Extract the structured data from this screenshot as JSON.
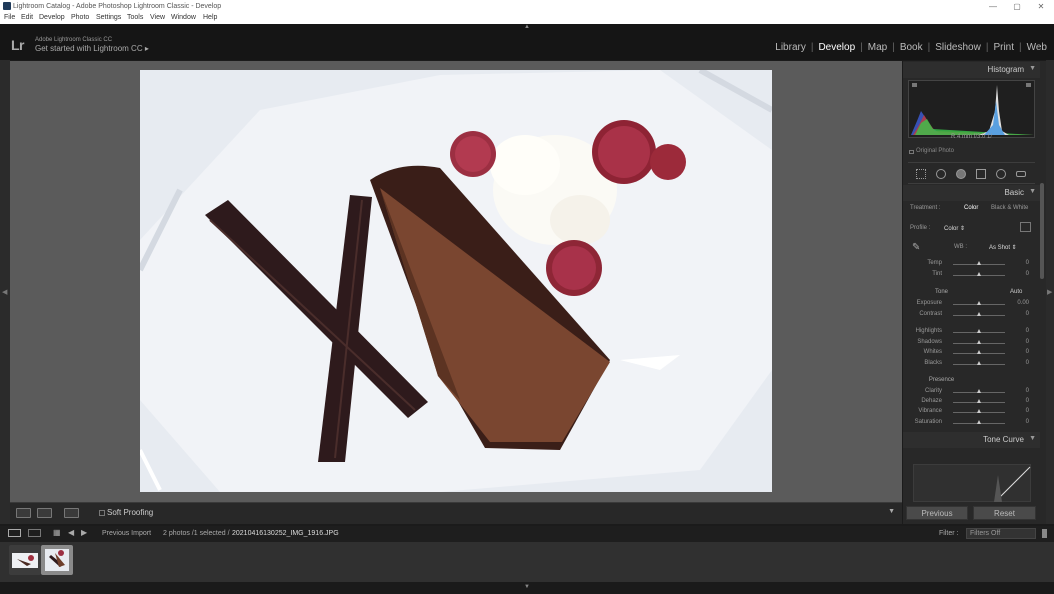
{
  "window": {
    "title": "Lightroom Catalog - Adobe Photoshop Lightroom Classic - Develop",
    "controls": [
      "—",
      "▢",
      "✕"
    ]
  },
  "menu": [
    "File",
    "Edit",
    "Develop",
    "Photo",
    "Settings",
    "Tools",
    "View",
    "Window",
    "Help"
  ],
  "identity": {
    "logo": "Lr",
    "line1": "Adobe Lightroom Classic CC",
    "line2": "Get started with Lightroom CC ▸"
  },
  "modules": [
    {
      "label": "Library",
      "active": false
    },
    {
      "label": "Develop",
      "active": true
    },
    {
      "label": "Map",
      "active": false
    },
    {
      "label": "Book",
      "active": false
    },
    {
      "label": "Slideshow",
      "active": false
    },
    {
      "label": "Print",
      "active": false
    },
    {
      "label": "Web",
      "active": false
    }
  ],
  "toolbar": {
    "soft_proofing": "Soft Proofing"
  },
  "histogram": {
    "title": "Histogram",
    "info": "R  4 mm  f/3.0  1/",
    "original_photo": "Original Photo"
  },
  "basic": {
    "title": "Basic",
    "treatment_label": "Treatment :",
    "treatment_color": "Color",
    "treatment_bw": "Black & White",
    "profile_label": "Profile :",
    "profile_value": "Color ⇕",
    "wb_label": "WB :",
    "wb_value": "As Shot ⇕",
    "tone_label": "Tone",
    "auto_label": "Auto",
    "presence_label": "Presence",
    "sliders": [
      {
        "name": "Temp",
        "value": "0",
        "pos": 0.5
      },
      {
        "name": "Tint",
        "value": "0",
        "pos": 0.5
      },
      {
        "name": "Exposure",
        "value": "0.00",
        "pos": 0.5
      },
      {
        "name": "Contrast",
        "value": "0",
        "pos": 0.5
      },
      {
        "name": "Highlights",
        "value": "0",
        "pos": 0.5
      },
      {
        "name": "Shadows",
        "value": "0",
        "pos": 0.5
      },
      {
        "name": "Whites",
        "value": "0",
        "pos": 0.5
      },
      {
        "name": "Blacks",
        "value": "0",
        "pos": 0.5
      },
      {
        "name": "Clarity",
        "value": "0",
        "pos": 0.5
      },
      {
        "name": "Dehaze",
        "value": "0",
        "pos": 0.5
      },
      {
        "name": "Vibrance",
        "value": "0",
        "pos": 0.5
      },
      {
        "name": "Saturation",
        "value": "0",
        "pos": 0.5
      }
    ]
  },
  "tone_curve": {
    "title": "Tone Curve"
  },
  "buttons": {
    "previous": "Previous",
    "reset": "Reset"
  },
  "filmbar": {
    "source": "Previous Import",
    "count": "2 photos /1 selected /",
    "filename": "20210416130252_IMG_1916.JPG",
    "filter_label": "Filter :",
    "filter_value": "Filters Off"
  },
  "colors": {
    "background": "#1b1b1b",
    "panel": "#282828",
    "canvas": "#5b5b5b"
  }
}
